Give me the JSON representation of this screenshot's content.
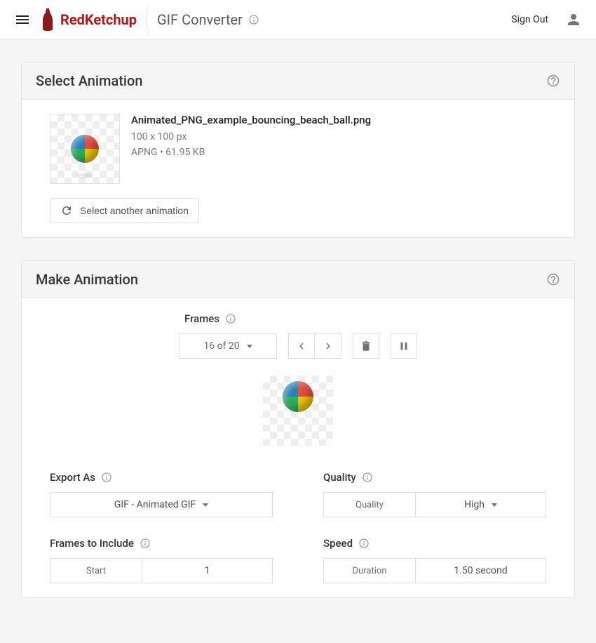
{
  "header": {
    "brand": "RedKetchup",
    "page_title": "GIF Converter",
    "sign_out": "Sign Out"
  },
  "select_animation": {
    "title": "Select Animation",
    "filename": "Animated_PNG_example_bouncing_beach_ball.png",
    "dimensions": "100 x 100 px",
    "format_line": "APNG • 61.95 KB",
    "select_another": "Select another animation"
  },
  "make_animation": {
    "title": "Make Animation",
    "frames_label": "Frames",
    "frame_count": "16 of 20",
    "export_as_label": "Export As",
    "export_as_value": "GIF - Animated GIF",
    "quality_label": "Quality",
    "quality_split_label": "Quality",
    "quality_value": "High",
    "frames_include_label": "Frames to Include",
    "frames_include_split_label": "Start",
    "frames_include_value": "1",
    "speed_label": "Speed",
    "speed_split_label": "Duration",
    "speed_value": "1.50 second"
  }
}
